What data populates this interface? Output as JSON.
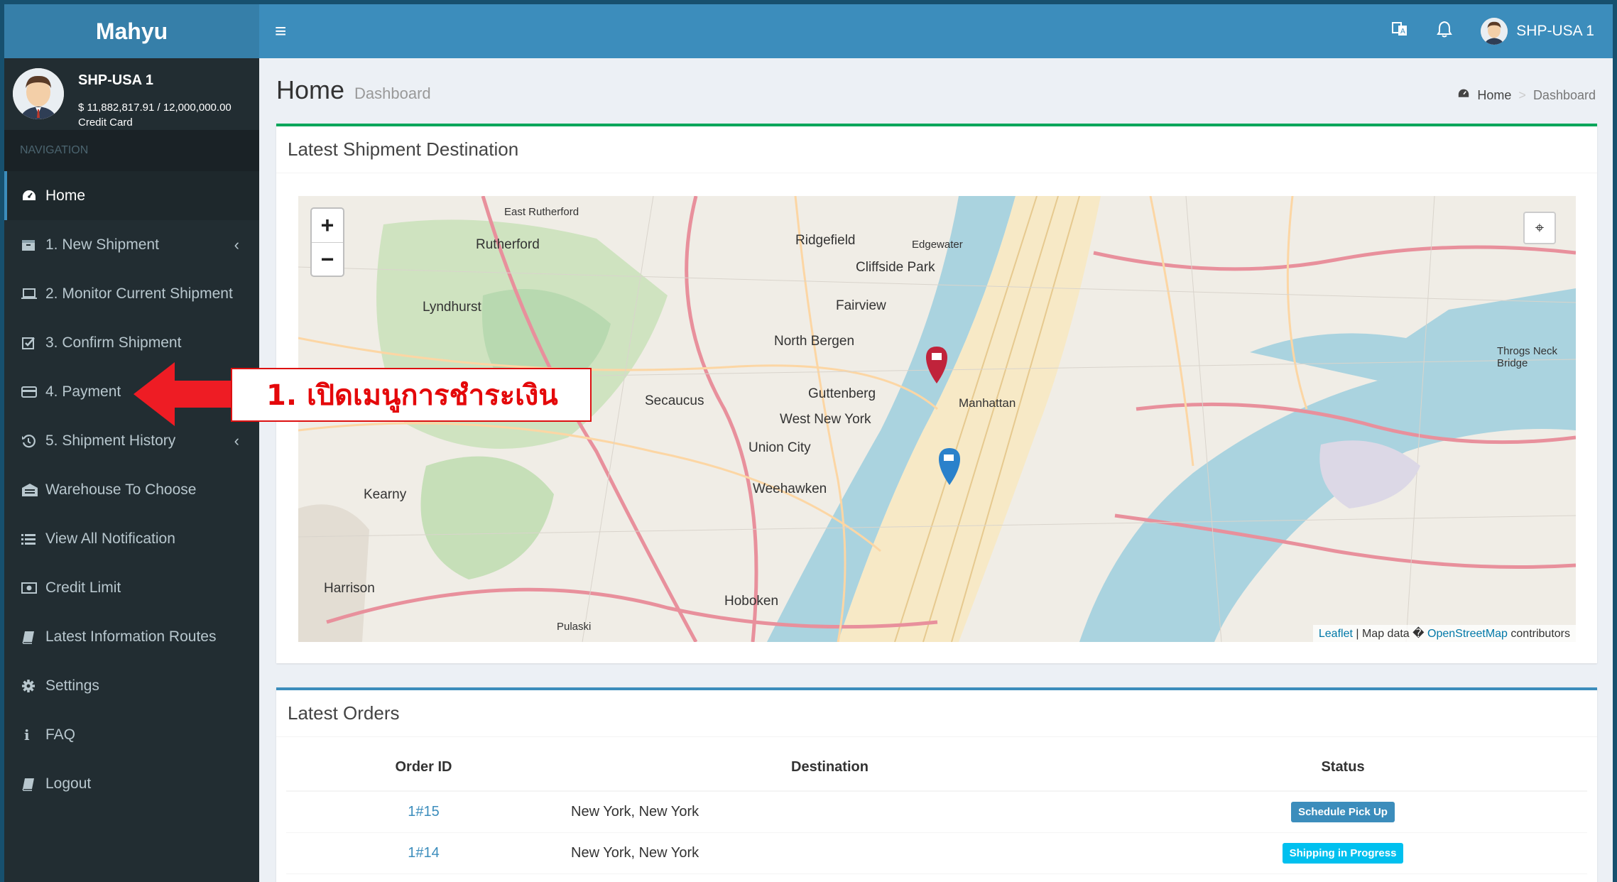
{
  "app": {
    "brand": "Mahyu"
  },
  "user": {
    "name": "SHP-USA 1",
    "balance": "$ 11,882,817.91 / 12,000,000.00",
    "payment_method": "Credit Card"
  },
  "sidebar": {
    "header": "NAVIGATION",
    "items": [
      {
        "label": "Home",
        "icon": "dashboard-icon"
      },
      {
        "label": "1. New Shipment",
        "icon": "shipment-box-icon"
      },
      {
        "label": "2. Monitor Current Shipment",
        "icon": "laptop-icon"
      },
      {
        "label": "3. Confirm Shipment",
        "icon": "check-square-icon"
      },
      {
        "label": "4. Payment",
        "icon": "credit-card-icon"
      },
      {
        "label": "5. Shipment History",
        "icon": "history-icon"
      },
      {
        "label": "Warehouse To Choose",
        "icon": "warehouse-icon"
      },
      {
        "label": "View All Notification",
        "icon": "list-icon"
      },
      {
        "label": "Credit Limit",
        "icon": "money-icon"
      },
      {
        "label": "Latest Information Routes",
        "icon": "book-icon"
      },
      {
        "label": "Settings",
        "icon": "gear-icon"
      },
      {
        "label": "FAQ",
        "icon": "info-icon"
      },
      {
        "label": "Logout",
        "icon": "book-icon"
      }
    ]
  },
  "topbar": {
    "user_name": "SHP-USA 1"
  },
  "page": {
    "title": "Home",
    "subtitle": "Dashboard"
  },
  "breadcrumb": {
    "home": "Home",
    "current": "Dashboard"
  },
  "map_box": {
    "title": "Latest Shipment Destination",
    "attribution_leaflet": "Leaflet",
    "attribution_mid": "| Map data �",
    "attribution_osm": "OpenStreetMap",
    "attribution_end": "contributors",
    "places": [
      "Ridgefield",
      "Rutherford",
      "Cliffside Park",
      "Fairview",
      "Lyndhurst",
      "North Bergen",
      "Secaucus",
      "Guttenberg",
      "Manhattan",
      "West New York",
      "Union City",
      "Weehawken",
      "Kearny",
      "Harrison",
      "Hoboken",
      "East Rutherford",
      "Edgewater",
      "Throgs Neck Bridge",
      "Pulaski"
    ]
  },
  "orders_box": {
    "title": "Latest Orders",
    "columns": [
      "Order ID",
      "Destination",
      "Status"
    ],
    "rows": [
      {
        "id": "1#15",
        "destination": "New York, New York",
        "status": "Schedule Pick Up",
        "color": "#3c8dbc"
      },
      {
        "id": "1#14",
        "destination": "New York, New York",
        "status": "Shipping in Progress",
        "color": "#00c0ef"
      }
    ]
  },
  "annotation": {
    "text": "1. เปิดเมนูการชำระเงิน"
  },
  "colors": {
    "brand": "#3c8dbc",
    "sidebar": "#222d32",
    "annotation": "#e4080a"
  }
}
